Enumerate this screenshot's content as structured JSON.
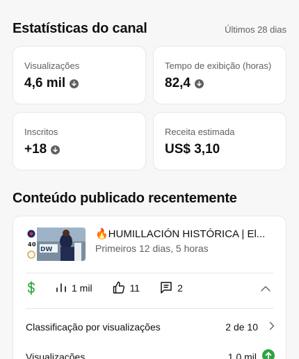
{
  "channel_stats": {
    "title": "Estatísticas do canal",
    "period": "Últimos 28 dias",
    "cards": [
      {
        "label": "Visualizações",
        "value": "4,6 mil",
        "trend": "down"
      },
      {
        "label": "Tempo de exibição (horas)",
        "value": "82,4",
        "trend": "down"
      },
      {
        "label": "Inscritos",
        "value": "+18",
        "trend": "down"
      },
      {
        "label": "Receita estimada",
        "value": "US$ 3,10",
        "trend": "none"
      }
    ]
  },
  "recent_content": {
    "title": "Conteúdo publicado recentemente",
    "video": {
      "title": "🔥HUMILLACIÓN HISTÓRICA | El...",
      "subtitle": "Primeiros 12 dias, 5 horas",
      "metrics": {
        "views": "1 mil",
        "likes": "11",
        "comments": "2"
      },
      "rows": [
        {
          "label": "Classificação por visualizações",
          "value": "2 de 10"
        },
        {
          "label": "Visualizações",
          "value": "1,0 mil"
        }
      ]
    }
  },
  "colors": {
    "monetization": "#2ba640",
    "trend_up": "#2ba640",
    "trend_down": "#606060"
  }
}
